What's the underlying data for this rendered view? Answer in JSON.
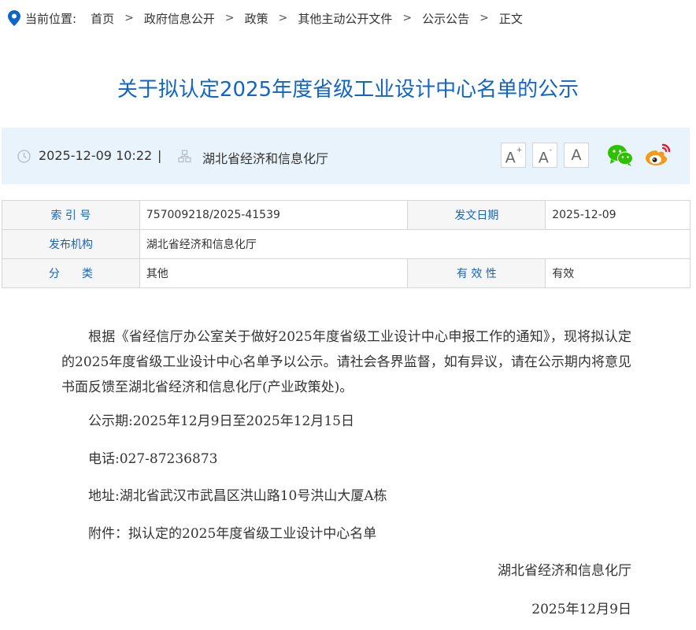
{
  "breadcrumb": {
    "prefix": "当前位置:",
    "items": [
      "首页",
      "政府信息公开",
      "政策",
      "其他主动公开文件",
      "公示公告",
      "正文"
    ],
    "separator": ">"
  },
  "article": {
    "title": "关于拟认定2025年度省级工业设计中心名单的公示",
    "datetime": "2025-12-09 10:22",
    "divider": "|",
    "source": "湖北省经济和信息化厅"
  },
  "toolbar": {
    "font_large": "A",
    "font_large_mark": "+",
    "font_small": "A",
    "font_small_mark": "-",
    "font_default": "A"
  },
  "meta": {
    "index_label": "索 引 号",
    "index_value": "757009218/2025-41539",
    "date_label": "发文日期",
    "date_value": "2025-12-09",
    "issuer_label": "发布机构",
    "issuer_value": "湖北省经济和信息化厅",
    "category_label": "分　　类",
    "category_value": "其他",
    "validity_label": "有 效 性",
    "validity_value": "有效"
  },
  "body": {
    "paragraph_1": "根据《省经信厅办公室关于做好2025年度省级工业设计中心申报工作的通知》，现将拟认定的2025年度省级工业设计中心名单予以公示。请社会各界监督，如有异议，请在公示期内将意见书面反馈至湖北省经济和信息化厅(产业政策处)。",
    "period": "公示期:2025年12月9日至2025年12月15日",
    "phone": "电话:027-87236873",
    "address": "地址:湖北省武汉市武昌区洪山路10号洪山大厦A栋",
    "attachment_label": "附件：",
    "attachment_link": "拟认定的2025年度省级工业设计中心名单",
    "signature_org": "湖北省经济和信息化厅",
    "signature_date": "2025年12月9日"
  },
  "colors": {
    "title_blue": "#1065c8",
    "info_bar_bg": "#e8f3fb",
    "wechat_green": "#2dc100",
    "weibo_orange": "#f39a1a",
    "weibo_red": "#e6162d"
  },
  "icons": [
    "location-pin-icon",
    "clock-icon",
    "org-icon",
    "wechat-icon",
    "weibo-icon"
  ]
}
